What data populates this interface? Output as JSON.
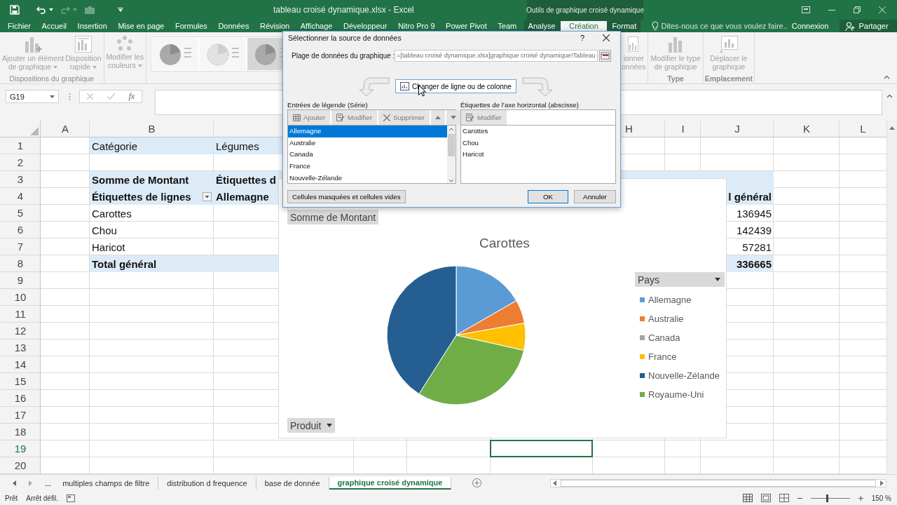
{
  "title_bar": {
    "title": "tableau croisé dynamique.xlsx - Excel",
    "context_label": "Outils de graphique croisé dynamique"
  },
  "tabs": [
    {
      "label": "Fichier",
      "selected": false
    },
    {
      "label": "Accueil",
      "selected": false
    },
    {
      "label": "Insertion",
      "selected": false
    },
    {
      "label": "Mise en page",
      "selected": false
    },
    {
      "label": "Formules",
      "selected": false
    },
    {
      "label": "Données",
      "selected": false
    },
    {
      "label": "Révision",
      "selected": false
    },
    {
      "label": "Affichage",
      "selected": false
    },
    {
      "label": "Développeur",
      "selected": false
    },
    {
      "label": "Nitro Pro 9",
      "selected": false
    },
    {
      "label": "Power Pivot",
      "selected": false
    },
    {
      "label": "Team",
      "selected": false
    }
  ],
  "context_tabs": [
    {
      "label": "Analyse",
      "selected": false
    },
    {
      "label": "Création",
      "selected": true
    },
    {
      "label": "Format",
      "selected": false
    }
  ],
  "tell_me": {
    "placeholder": "Dites-nous ce que vous voulez faire.."
  },
  "account": {
    "sign_in": "Connexion",
    "share": "Partager"
  },
  "ribbon": {
    "left_groups": [
      {
        "label": "Dispositions du graphique",
        "buttons": [
          {
            "label": "Ajouter un élément\nde graphique",
            "kind": "chart-element",
            "menu": true
          },
          {
            "label": "Disposition\nrapide",
            "kind": "layout",
            "menu": true
          }
        ]
      },
      {
        "buttons": [
          {
            "label": "Modifier les\ncouleurs",
            "kind": "colors",
            "menu": true
          }
        ]
      }
    ],
    "right_groups": [
      {
        "buttons": [
          {
            "label": "ionner\nonnées",
            "kind": "select-data",
            "menu": false
          }
        ]
      },
      {
        "label": "Type",
        "buttons": [
          {
            "label": "Modifier le type\nde graphique",
            "kind": "chart-type",
            "menu": false
          }
        ]
      },
      {
        "label": "Emplacement",
        "buttons": [
          {
            "label": "Déplacer le\ngraphique",
            "kind": "move",
            "menu": false
          }
        ]
      }
    ]
  },
  "formula_bar": {
    "name_box": "G19",
    "function_label": "fx"
  },
  "sheet": {
    "column_headers": {
      "A": "A",
      "B": "B",
      "H": "H",
      "I": "I",
      "J": "J",
      "K": "K",
      "L": "L"
    },
    "rows": [
      {
        "number": "1",
        "kind": "filter",
        "selected": false,
        "B": "Catégorie",
        "C": "Légumes"
      },
      {
        "number": "2",
        "kind": "blank",
        "selected": false
      },
      {
        "number": "3",
        "kind": "header",
        "selected": false,
        "B": "Somme de Montant",
        "C": "Étiquettes d"
      },
      {
        "number": "4",
        "kind": "header",
        "selected": false,
        "B": "Étiquettes de lignes",
        "C": "Allemagne",
        "J": "l général",
        "filter_button": true
      },
      {
        "number": "5",
        "kind": "item",
        "selected": false,
        "B": "Carottes",
        "J": "136945"
      },
      {
        "number": "6",
        "kind": "item",
        "selected": false,
        "B": "Chou",
        "J": "142439"
      },
      {
        "number": "7",
        "kind": "item",
        "selected": false,
        "B": "Haricot",
        "J": "57281"
      },
      {
        "number": "8",
        "kind": "total",
        "selected": false,
        "B": "Total général",
        "J": "336665"
      },
      {
        "number": "9",
        "kind": "blank",
        "selected": false
      },
      {
        "number": "10",
        "kind": "blank",
        "selected": false
      },
      {
        "number": "11",
        "kind": "blank",
        "selected": false
      },
      {
        "number": "12",
        "kind": "blank",
        "selected": false
      },
      {
        "number": "13",
        "kind": "blank",
        "selected": false
      },
      {
        "number": "14",
        "kind": "blank",
        "selected": false
      },
      {
        "number": "15",
        "kind": "blank",
        "selected": false
      },
      {
        "number": "16",
        "kind": "blank",
        "selected": false
      },
      {
        "number": "17",
        "kind": "blank",
        "selected": false
      },
      {
        "number": "18",
        "kind": "blank",
        "selected": false
      },
      {
        "number": "19",
        "kind": "blank",
        "selected": true
      },
      {
        "number": "20",
        "kind": "blank",
        "selected": false
      }
    ]
  },
  "chart": {
    "field_button": "Somme de Montant",
    "title": "Carottes",
    "legend_field": "Pays",
    "axis_field": "Produit",
    "legend": [
      {
        "label": "Allemagne",
        "color": "#5b9bd5"
      },
      {
        "label": "Australie",
        "color": "#ed7d31"
      },
      {
        "label": "Canada",
        "color": "#a5a5a5"
      },
      {
        "label": "France",
        "color": "#ffc000"
      },
      {
        "label": "Nouvelle-Zélande",
        "color": "#255e91"
      },
      {
        "label": "Royaume-Uni",
        "color": "#70ad47"
      }
    ]
  },
  "dialog": {
    "title": "Sélectionner la source de données",
    "help": "?",
    "range_label": "Plage de données du graphique :",
    "range_value": "=[tableau croisé dynamique.xlsx]graphique croisé dynamique!Tableau",
    "switch_button": "Changer de ligne ou de colonne",
    "series_label": "Entrées de légende (Série)",
    "series_tools": [
      {
        "label": "Ajouter",
        "kind": "add",
        "disabled": true
      },
      {
        "label": "Modifier",
        "kind": "edit",
        "disabled": true
      },
      {
        "label": "Supprimer",
        "kind": "delete",
        "disabled": true
      },
      {
        "kind": "up",
        "disabled": true
      },
      {
        "kind": "down",
        "disabled": true
      }
    ],
    "series": [
      {
        "label": "Allemagne",
        "selected": true
      },
      {
        "label": "Australie",
        "selected": false
      },
      {
        "label": "Canada",
        "selected": false
      },
      {
        "label": "France",
        "selected": false
      },
      {
        "label": "Nouvelle-Zélande",
        "selected": false
      }
    ],
    "axis_label": "Étiquettes de l’axe horizontal (abscisse)",
    "axis_tools": [
      {
        "label": "Modifier",
        "kind": "edit",
        "disabled": true
      }
    ],
    "axis_items": [
      "Carottes",
      "Chou",
      "Haricot"
    ],
    "hidden_cells_button": "Cellules masquées et cellules vides",
    "ok": "OK",
    "cancel": "Annuler"
  },
  "sheet_tabs": {
    "overflow": "...",
    "tabs": [
      {
        "label": "multiples champs de filtre",
        "selected": false
      },
      {
        "label": "distribution d frequence",
        "selected": false
      },
      {
        "label": "base de donnée",
        "selected": false
      },
      {
        "label": "graphique croisé dynamique",
        "selected": true
      }
    ]
  },
  "status_bar": {
    "ready": "Prêt",
    "scroll_lock": "Arrêt défil.",
    "zoom": {
      "level": 0.4,
      "label": "150 %"
    }
  }
}
